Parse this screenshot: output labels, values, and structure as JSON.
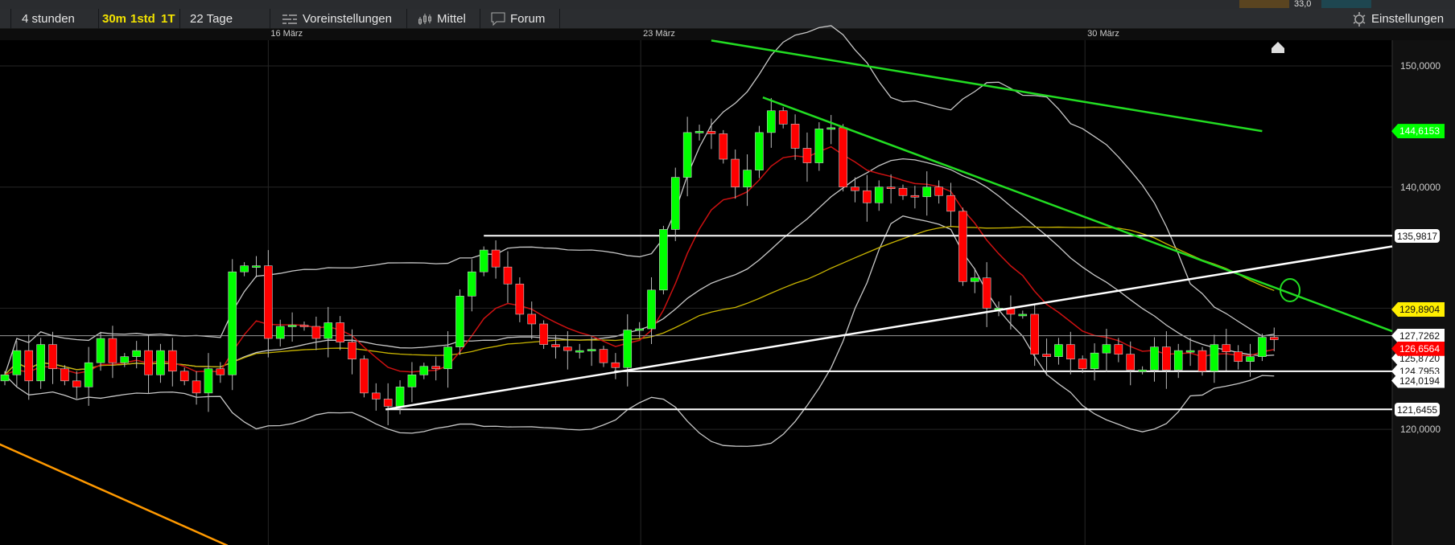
{
  "toolbar": {
    "interval": "4 stunden",
    "quick": [
      "30m",
      "1std",
      "1T"
    ],
    "range": "22 Tage",
    "presets": "Voreinstellungen",
    "indicators": "Mittel",
    "forum": "Forum",
    "settings": "Einstellungen",
    "top_value": "33,0"
  },
  "chart_data": {
    "type": "candlestick",
    "x_labels": [
      {
        "index": 22,
        "label": "16 März"
      },
      {
        "index": 53.1,
        "label": "23 März"
      },
      {
        "index": 90.2,
        "label": "30 März"
      }
    ],
    "y_ticks": [
      "150,0000",
      "140,0000",
      "120,0000"
    ],
    "y_tick_values": [
      150,
      140,
      120
    ],
    "ylim": [
      110.45,
      152.8
    ],
    "closes": [
      124.5,
      126.5,
      124,
      127,
      125,
      124,
      123.5,
      125.5,
      127.5,
      125.5,
      126,
      126.5,
      124.5,
      126.5,
      124.8,
      124,
      123,
      125,
      124.5,
      133,
      133.5,
      133.5,
      127.5,
      128.5,
      128.6,
      128.5,
      127.5,
      128.8,
      127.2,
      125.8,
      123,
      122.5,
      121.9,
      123.5,
      124.5,
      125.2,
      125,
      126.8,
      131,
      133,
      134.8,
      133.4,
      132,
      129.5,
      128.7,
      127,
      126.8,
      126.5,
      126.5,
      126.6,
      125.5,
      125.1,
      128.2,
      128.3,
      131.5,
      136.5,
      140.8,
      144.5,
      144.6,
      144.4,
      142.3,
      140,
      141.4,
      144.5,
      146.3,
      145.2,
      143.2,
      142,
      144.8,
      144.9,
      140,
      139.7,
      138.7,
      140,
      139.9,
      139.3,
      139.2,
      140,
      139.3,
      138,
      132.2,
      132.5,
      130,
      130,
      129.5,
      129.5,
      126.2,
      126,
      127,
      125.8,
      125,
      126.3,
      127,
      126.2,
      124.9,
      124.9,
      126.8,
      124.9,
      126.5,
      126.5,
      124.8,
      127,
      126.4,
      125.6,
      126,
      127.6,
      127.4
    ],
    "first_open": 124,
    "indicators": {
      "bollinger_period": 20,
      "bollinger_sd": 2,
      "ema_period": 9,
      "sma_period": 40
    },
    "trendlines": [
      {
        "name": "green-resistance-long",
        "color": "#22dd22",
        "from": [
          59,
          152.1
        ],
        "to": [
          105,
          144.6153
        ]
      },
      {
        "name": "green-resistance-short",
        "color": "#22dd22",
        "from": [
          63.3,
          147.4
        ],
        "to": [
          116,
          128.1
        ]
      },
      {
        "name": "white-support-rising",
        "color": "#ffffff",
        "from": [
          31.8,
          121.6455
        ],
        "to": [
          116,
          135.1
        ]
      },
      {
        "name": "orange-line",
        "color": "#ff9900",
        "from": [
          -0.5,
          118.8
        ],
        "to": [
          18.6,
          110.4
        ]
      }
    ],
    "hlines": [
      {
        "name": "hline-135",
        "value": 135.9817,
        "from": 40,
        "color": "#ffffff"
      },
      {
        "name": "hline-124",
        "value": 124.7953,
        "from": 50.9,
        "color": "#ffffff"
      },
      {
        "name": "hline-121",
        "value": 121.6455,
        "from": 31.8,
        "color": "#ffffff"
      },
      {
        "name": "current-price-line",
        "value": 127.7262,
        "from": -1,
        "color": "#999999"
      }
    ],
    "price_labels": [
      {
        "value": "125,8720",
        "price": 125.872,
        "bg": "#ffffff",
        "fg": "#111"
      },
      {
        "value": "124,7953",
        "price": 124.7953,
        "bg": "#ffffff",
        "fg": "#111"
      },
      {
        "value": "144,6153",
        "price": 144.6153,
        "bg": "#00ff00",
        "fg": "#ffffff"
      },
      {
        "value": "129,8904",
        "price": 129.8904,
        "bg": "#ffee00",
        "fg": "#111"
      },
      {
        "value": "127,7262",
        "price": 127.7262,
        "bg": "#ffffff",
        "fg": "#111"
      },
      {
        "value": "126,6564",
        "price": 126.6564,
        "bg": "#ff0000",
        "fg": "#ffffff"
      },
      {
        "value": "124,0194",
        "price": 124.0194,
        "bg": "#ffffff",
        "fg": "#111"
      }
    ],
    "box_labels": [
      {
        "value": "135,9817",
        "price": 135.9817
      },
      {
        "value": "121,6455",
        "price": 121.6455
      }
    ],
    "colors": {
      "up": "#00ff00",
      "down": "#ff0000",
      "band": "#c8c8c8",
      "ema": "#cc1111",
      "sma": "#c8b400"
    }
  }
}
